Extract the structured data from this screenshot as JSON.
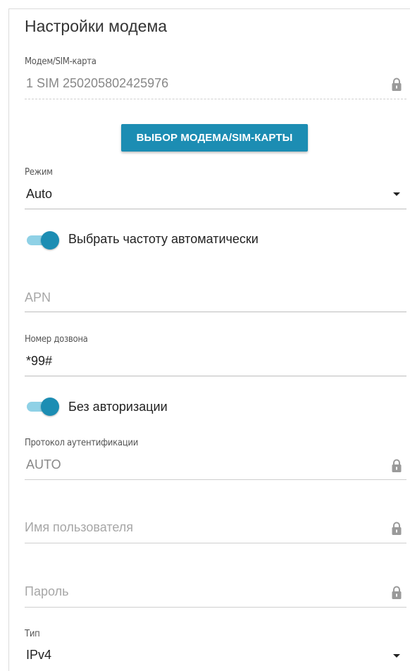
{
  "title": "Настройки модема",
  "modem": {
    "label": "Модем/SIM-карта",
    "value": "1 SIM 250205802425976"
  },
  "select_button": "ВЫБОР МОДЕМА/SIM-КАРТЫ",
  "mode": {
    "label": "Режим",
    "value": "Auto"
  },
  "auto_freq": {
    "label": "Выбрать частоту автоматически",
    "enabled": true
  },
  "apn": {
    "placeholder": "APN",
    "value": ""
  },
  "dial": {
    "label": "Номер дозвона",
    "value": "*99#"
  },
  "no_auth": {
    "label": "Без авторизации",
    "enabled": true
  },
  "auth_protocol": {
    "label": "Протокол аутентификации",
    "value": "AUTO"
  },
  "username": {
    "placeholder": "Имя пользователя"
  },
  "password": {
    "placeholder": "Пароль"
  },
  "type": {
    "label": "Тип",
    "value": "IPv4"
  },
  "colors": {
    "accent": "#1c8db3",
    "toggle_track": "#8fd1e6"
  },
  "icons": {
    "lock": "lock-icon",
    "caret": "caret-down-icon"
  }
}
